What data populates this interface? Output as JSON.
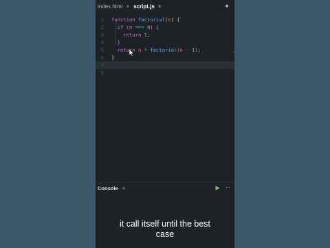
{
  "tabs": [
    {
      "label": "index.html",
      "close": "×",
      "active": false
    },
    {
      "label": "script.js",
      "close": "×",
      "active": true
    }
  ],
  "toolbar": {
    "magic_icon": "sparkle-icon",
    "magic_glyph": "✦"
  },
  "editor": {
    "line_numbers": [
      "1",
      "2",
      "3",
      "4",
      "5",
      "6",
      "7",
      "8"
    ],
    "lines": [
      "function factorial(n) {",
      "  if (n === 0) {",
      "    return 1;",
      "  }",
      "  return n * factorial(n - 1);",
      "}",
      "",
      ""
    ],
    "current_line": 7
  },
  "console": {
    "title": "Console",
    "close": "×",
    "run_icon": "play-icon",
    "more_icon": "more-icon",
    "more_glyph": "···"
  },
  "caption": {
    "line1": "it call itself until the best",
    "line2": "case"
  },
  "colors": {
    "background": "#3b5569",
    "editor_bg": "#1e2227",
    "keyword": "#c678dd",
    "function": "#61afef",
    "number": "#d19a66",
    "operator": "#56b6c2",
    "run": "#7ec45a"
  }
}
